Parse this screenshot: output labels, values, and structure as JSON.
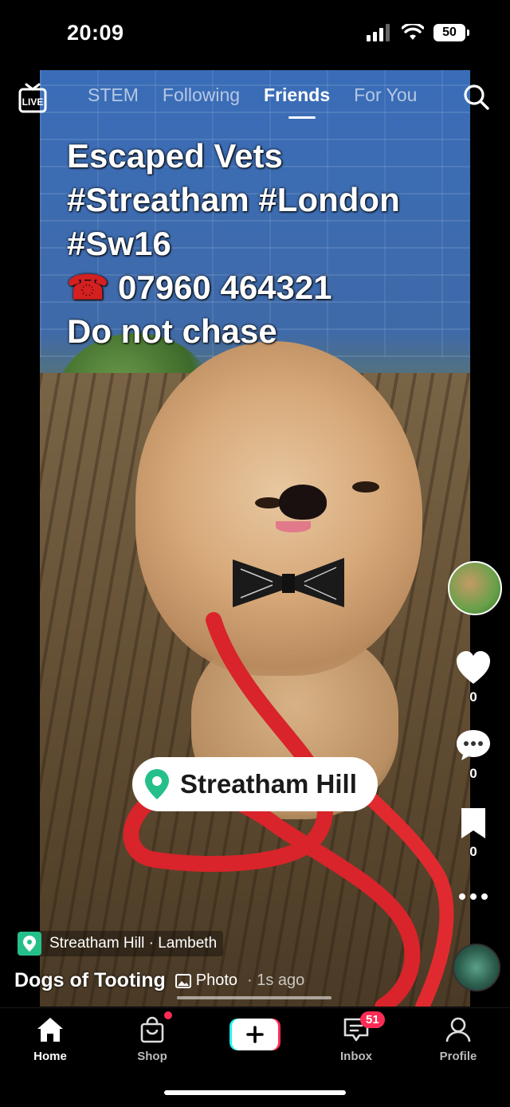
{
  "status_bar": {
    "time": "20:09",
    "battery": "50"
  },
  "top_nav": {
    "live_label": "LIVE",
    "tabs": [
      {
        "label": "STEM",
        "active": false
      },
      {
        "label": "Following",
        "active": false
      },
      {
        "label": "Friends",
        "active": true
      },
      {
        "label": "For You",
        "active": false
      }
    ]
  },
  "post": {
    "caption_lines": [
      "Escaped Vets",
      "#Streatham #London",
      "#Sw16",
      "07960 464321",
      "Do not chase"
    ],
    "phone_icon": "☎",
    "location_sticker": "Streatham Hill",
    "place": "Streatham Hill · Lambeth",
    "author": "Dogs of Tooting",
    "type_label": "Photo",
    "time_ago": "· 1s ago"
  },
  "actions": {
    "likes": "0",
    "comments": "0",
    "saves": "0"
  },
  "tab_bar": {
    "home": "Home",
    "shop": "Shop",
    "inbox": "Inbox",
    "inbox_badge": "51",
    "profile": "Profile"
  },
  "colors": {
    "accent": "#fe2c55",
    "cyan": "#25f4ee",
    "location_green": "#25c08a"
  }
}
